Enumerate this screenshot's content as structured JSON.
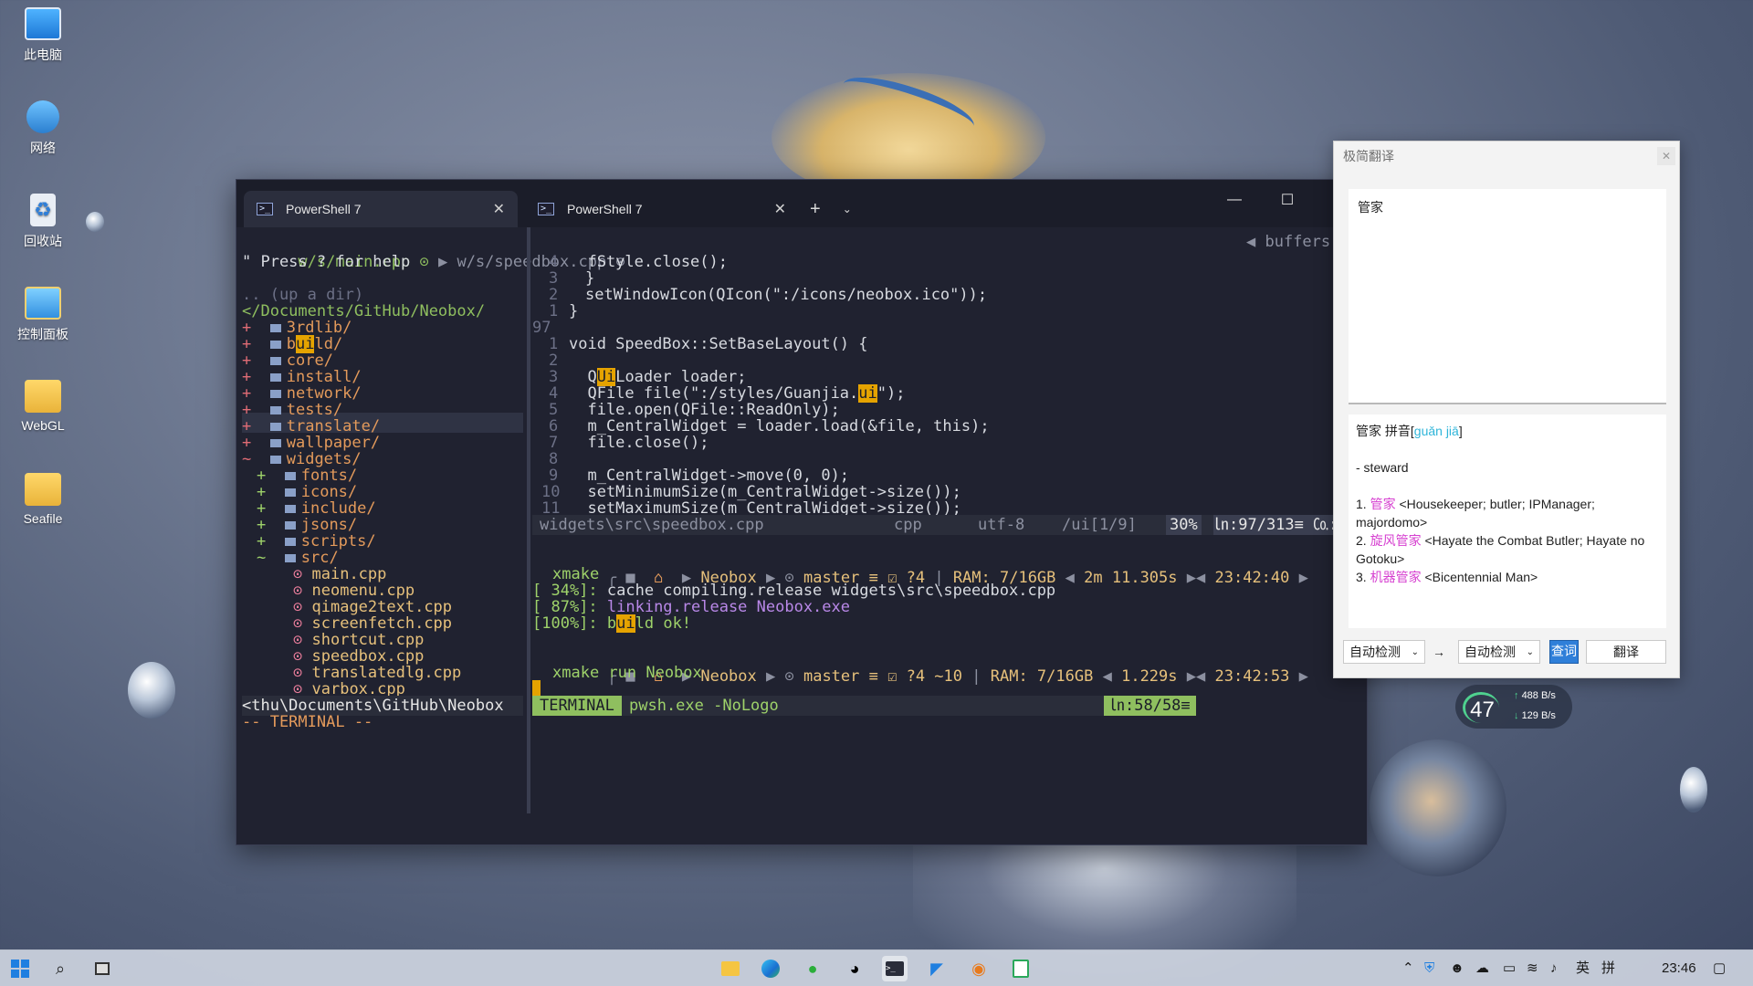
{
  "desktop": {
    "icons": [
      {
        "label": "此电脑"
      },
      {
        "label": "网络"
      },
      {
        "label": "回收站"
      },
      {
        "label": "控制面板"
      },
      {
        "label": "WebGL"
      },
      {
        "label": "Seafile"
      }
    ]
  },
  "terminal": {
    "tabs": [
      {
        "label": "PowerShell 7",
        "close": "✕"
      },
      {
        "label": "PowerShell 7",
        "close": "✕"
      }
    ],
    "new_tab": "+",
    "dropdown": "⌄",
    "controls": {
      "minimize": "—",
      "maximize": "☐",
      "close": "✕"
    },
    "tabline": {
      "file1": "w/s/main.cpp",
      "file2": "w/s/speedbox.cpp",
      "buffers": "buffers"
    },
    "tree": {
      "help": "\" Press ? for help",
      "up_dir": ".. (up a dir)",
      "root": "</Documents/GitHub/Neobox/",
      "items": [
        {
          "prefix": "+",
          "name": "3rdlib/"
        },
        {
          "prefix": "+",
          "name_pre": "b",
          "name_hl": "ui",
          "name_post": "ld/"
        },
        {
          "prefix": "+",
          "name": "core/"
        },
        {
          "prefix": "+",
          "name": "install/"
        },
        {
          "prefix": "+",
          "name": "network/"
        },
        {
          "prefix": "+",
          "name": "tests/"
        },
        {
          "prefix": "+",
          "name": "translate/"
        },
        {
          "prefix": "+",
          "name": "wallpaper/"
        },
        {
          "prefix": "~",
          "name": "widgets/"
        }
      ],
      "sub_items": [
        {
          "prefix": "+",
          "name": "fonts/"
        },
        {
          "prefix": "+",
          "name": "icons/"
        },
        {
          "prefix": "+",
          "name": "include/"
        },
        {
          "prefix": "+",
          "name": "jsons/"
        },
        {
          "prefix": "+",
          "name": "scripts/"
        },
        {
          "prefix": "~",
          "name": "src/"
        }
      ],
      "files": [
        "main.cpp",
        "neomenu.cpp",
        "qimage2text.cpp",
        "screenfetch.cpp",
        "shortcut.cpp",
        "speedbox.cpp",
        "translatedlg.cpp",
        "varbox.cpp"
      ],
      "path_status": "<thu\\Documents\\GitHub\\Neobox",
      "mode": "-- TERMINAL --"
    },
    "code": {
      "lines": [
        {
          "num": "4",
          "text": "  fStyle.close();"
        },
        {
          "num": "3",
          "text": "}"
        },
        {
          "num": "2",
          "text": "setWindowIcon(QIcon(\":/icons/neobox.ico\"));"
        },
        {
          "num": "1",
          "text": "}"
        },
        {
          "num": "97",
          "text": ""
        },
        {
          "num": "1",
          "text": "void SpeedBox::SetBaseLayout() {"
        },
        {
          "num": "2",
          "text": ""
        },
        {
          "num": "3",
          "pre": "  Q",
          "hl": "Ui",
          "post": "Loader loader;"
        },
        {
          "num": "4",
          "pre": "  QFile file(\":/styles/Guanjia.",
          "hl": "ui",
          "post": "\");"
        },
        {
          "num": "5",
          "text": "  file.open(QFile::ReadOnly);"
        },
        {
          "num": "6",
          "text": "  m_CentralWidget = loader.load(&file, this);"
        },
        {
          "num": "7",
          "text": "  file.close();"
        },
        {
          "num": "8",
          "text": ""
        },
        {
          "num": "9",
          "text": "  m_CentralWidget->move(0, 0);"
        },
        {
          "num": "10",
          "text": "  setMinimumSize(m_CentralWidget->size());"
        },
        {
          "num": "11",
          "text": "  setMaximumSize(m_CentralWidget->size());"
        }
      ],
      "status": {
        "file": "widgets\\src\\speedbox.cpp",
        "ft": "cpp",
        "enc": "utf-8",
        "search": "/ui[1/9]",
        "pct": "30%",
        "pos": "㏑:97/313≡ ㏇:1"
      }
    },
    "shell": {
      "prompt1": {
        "dir": "Neobox",
        "branch": "master",
        "status": "≡ ☑ ?4",
        "ram": "RAM: 7/16GB",
        "time": "2m 11.305s",
        "clock": "23:42:40"
      },
      "cmd1": "xmake",
      "out": [
        {
          "pct": "[ 34%]:",
          "text": " cache compiling.release widgets\\src\\speedbox.cpp"
        },
        {
          "pct": "[ 87%]:",
          "text": " linking.release Neobox.exe"
        },
        {
          "pct": "[100%]:",
          "text_pre": " b",
          "text_hl": "ui",
          "text_post": "ld ok!"
        }
      ],
      "prompt2": {
        "dir": "Neobox",
        "branch": "master",
        "status": "≡ ☑ ?4 ~10",
        "ram": "RAM: 7/16GB",
        "time": "1.229s",
        "clock": "23:42:53"
      },
      "cmd2": "xmake run Neobox",
      "status": {
        "mode": "TERMINAL",
        "cmd": "pwsh.exe -NoLogo",
        "pos": "㏑:58/58≡"
      }
    }
  },
  "translator": {
    "title": "极简翻译",
    "close": "✕",
    "input": "管家",
    "output": {
      "head": "管家 拼音[",
      "pinyin": "guǎn jiā",
      "head_end": "]",
      "def": "- steward",
      "items": [
        {
          "n": "1.",
          "term": "管家",
          "desc": "<Housekeeper; butler; IPManager; majordomo>"
        },
        {
          "n": "2.",
          "term": "旋风管家",
          "desc": "<Hayate the Combat Butler; Hayate no Gotoku>"
        },
        {
          "n": "3.",
          "term": "机器管家",
          "desc": "<Bicentennial Man>"
        }
      ]
    },
    "from": "自动检测",
    "arrow": "→",
    "to": "自动检测",
    "query_btn": "查词",
    "translate_btn": "翻译"
  },
  "netmon": {
    "cpu": "47",
    "up": "488 B/s",
    "down": "129 B/s"
  },
  "taskbar": {
    "lang": "英",
    "ime": "拼",
    "clock": "23:46"
  }
}
